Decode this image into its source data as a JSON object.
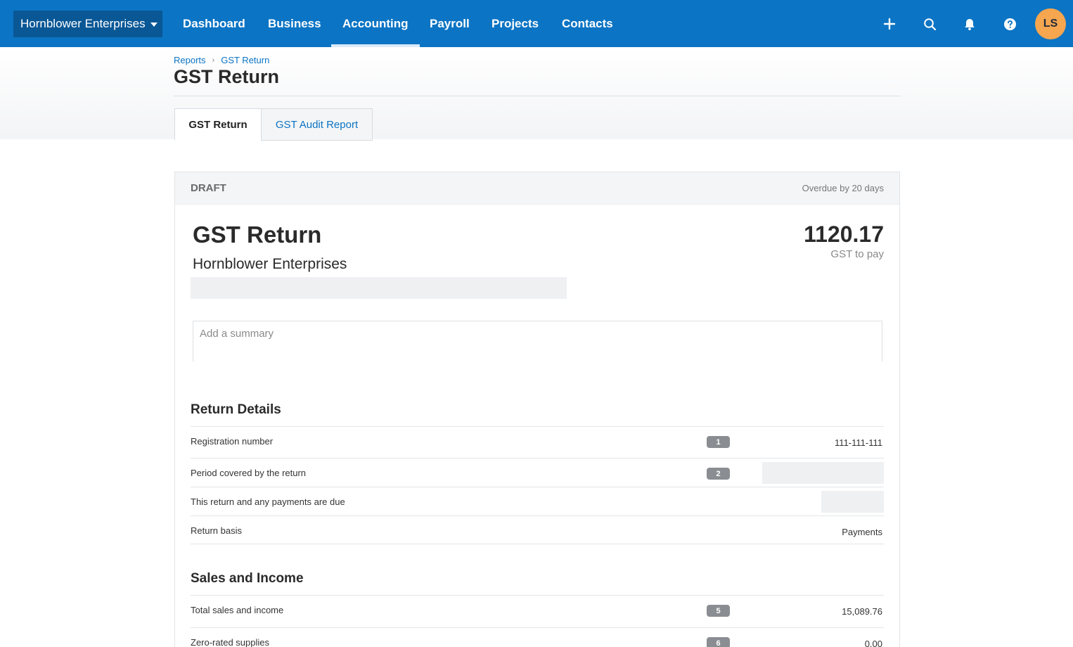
{
  "nav": {
    "org_switch": "Hornblower Enterprises",
    "items": [
      {
        "label": "Dashboard"
      },
      {
        "label": "Business"
      },
      {
        "label": "Accounting"
      },
      {
        "label": "Payroll"
      },
      {
        "label": "Projects"
      },
      {
        "label": "Contacts"
      }
    ],
    "active_item": "Accounting",
    "avatar_initials": "LS",
    "icons": [
      "plus-icon",
      "search-icon",
      "bell-icon",
      "help-icon"
    ],
    "brand_color": "#0b74c4"
  },
  "breadcrumb": {
    "items": [
      "Reports",
      "GST Return"
    ]
  },
  "page_title": "GST Return",
  "tabs": [
    {
      "label": "GST Return",
      "active": true
    },
    {
      "label": "GST Audit Report",
      "active": false
    }
  ],
  "return": {
    "status": "DRAFT",
    "overdue": "Overdue by 20 days",
    "title": "GST Return",
    "organisation": "Hornblower Enterprises",
    "amount": "1120.17",
    "amount_label": "GST to pay",
    "summary_placeholder": "Add a summary"
  },
  "return_details": {
    "title": "Return Details",
    "rows": [
      {
        "label": "Registration number",
        "box": "1",
        "value": "111-111-111"
      },
      {
        "label": "Period covered by the return",
        "box": "2",
        "value": ""
      },
      {
        "label": "This return and any payments are due",
        "box": "",
        "value": ""
      },
      {
        "label": "Return basis",
        "box": "",
        "value": "Payments"
      }
    ]
  },
  "sales_income": {
    "title": "Sales and Income",
    "rows": [
      {
        "label": "Total sales and income",
        "box": "5",
        "value": "15,089.76"
      },
      {
        "label": "Zero-rated supplies",
        "box": "6",
        "value": "0.00"
      }
    ]
  }
}
